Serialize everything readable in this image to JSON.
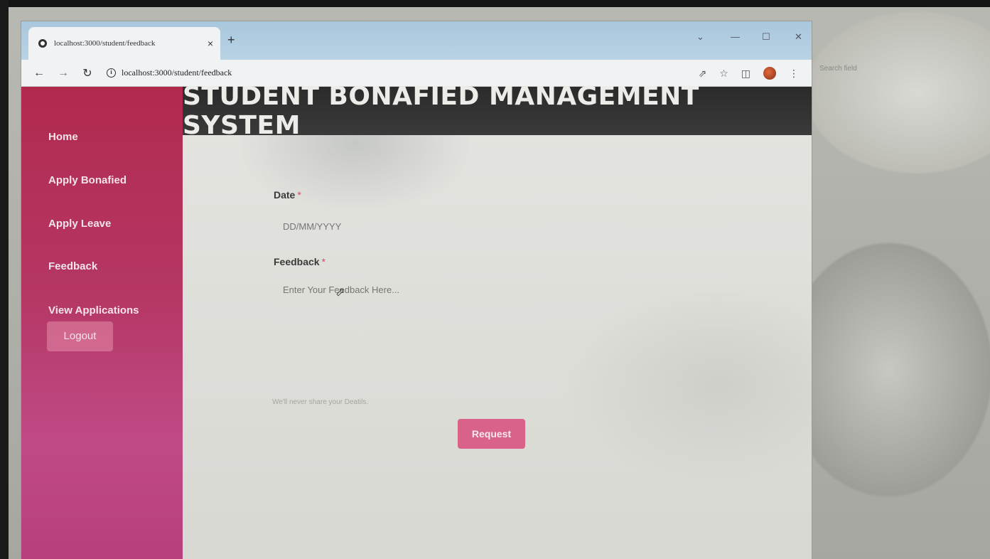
{
  "browser": {
    "tab_title": "localhost:3000/student/feedback",
    "tab_close": "×",
    "new_tab": "+",
    "address": "localhost:3000/student/feedback",
    "outside_search_ghost": "Search field"
  },
  "header": {
    "title": "STUDENT BONAFIED MANAGEMENT SYSTEM"
  },
  "sidebar": {
    "items": [
      {
        "label": "Home"
      },
      {
        "label": "Apply Bonafied"
      },
      {
        "label": "Apply Leave"
      },
      {
        "label": "Feedback"
      },
      {
        "label": "View Applications"
      }
    ],
    "logout_label": "Logout"
  },
  "form": {
    "date_label": "Date",
    "date_placeholder": "DD/MM/YYYY",
    "feedback_label": "Feedback",
    "feedback_placeholder": "Enter Your Feedback Here...",
    "required_mark": "*",
    "hint": "We'll never share your Deatils.",
    "submit_label": "Request"
  },
  "colors": {
    "sidebar": "#b53765",
    "banner": "#2f2f2f",
    "request_button": "#d8628a"
  }
}
